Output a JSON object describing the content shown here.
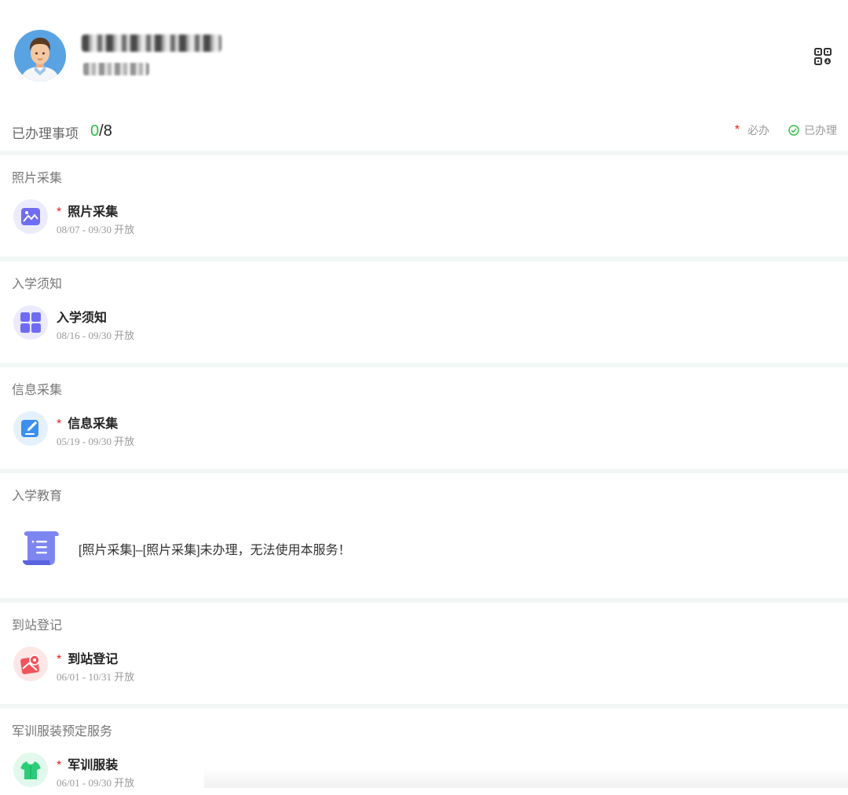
{
  "progress": {
    "label": "已办理事项",
    "done": "0",
    "separator": "/",
    "total": "8"
  },
  "legend": {
    "required_mark": "*",
    "required_label": "必办",
    "done_label": "已办理"
  },
  "sections": [
    {
      "title": "照片采集",
      "item_name": "照片采集",
      "required": "*",
      "date": "08/07 - 09/30 开放",
      "icon": "photo-icon"
    },
    {
      "title": "入学须知",
      "item_name": "入学须知",
      "date": "08/16 - 09/30 开放",
      "icon": "grid-icon"
    },
    {
      "title": "信息采集",
      "item_name": "信息采集",
      "required": "*",
      "date": "05/19 - 09/30 开放",
      "icon": "edit-icon"
    },
    {
      "title": "入学教育",
      "notice": "[照片采集]–[照片采集]未办理，无法使用本服务！",
      "icon": "scroll-icon"
    },
    {
      "title": "到站登记",
      "item_name": "到站登记",
      "required": "*",
      "date": "06/01 - 10/31 开放",
      "icon": "map-pin-icon"
    },
    {
      "title": "军训服装预定服务",
      "item_name": "军训服装",
      "required": "*",
      "date": "06/01 - 09/30 开放",
      "icon": "tshirt-icon"
    }
  ],
  "colors": {
    "accent_green": "#2bbf3f",
    "required_red": "#e02020",
    "divider": "#f2f7f6"
  }
}
